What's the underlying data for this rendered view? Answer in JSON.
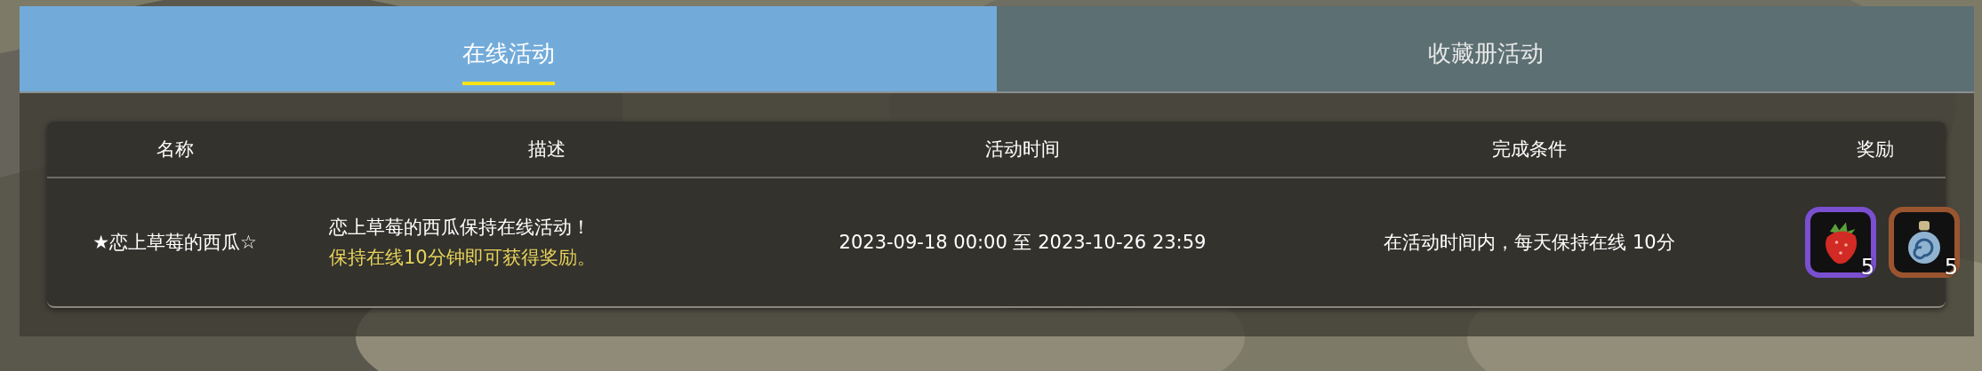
{
  "tabs": [
    {
      "label": "在线活动",
      "selected": true
    },
    {
      "label": "收藏册活动",
      "selected": false
    }
  ],
  "table": {
    "columns": [
      "名称",
      "描述",
      "活动时间",
      "完成条件",
      "奖励"
    ],
    "rows": [
      {
        "name": "★恋上草莓的西瓜☆",
        "description": {
          "line": "恋上草莓的西瓜保持在线活动！",
          "highlight": "保持在线10分钟即可获得奖励。"
        },
        "time": "2023-09-18 00:00 至 2023-10-26 23:59",
        "condition": "在活动时间内，每天保持在线 10分",
        "rewards": [
          {
            "kind": "strawberry",
            "color": "#7a4fd0",
            "count": "5"
          },
          {
            "kind": "potion",
            "color": "#9a5530",
            "count": "5"
          }
        ]
      }
    ]
  }
}
